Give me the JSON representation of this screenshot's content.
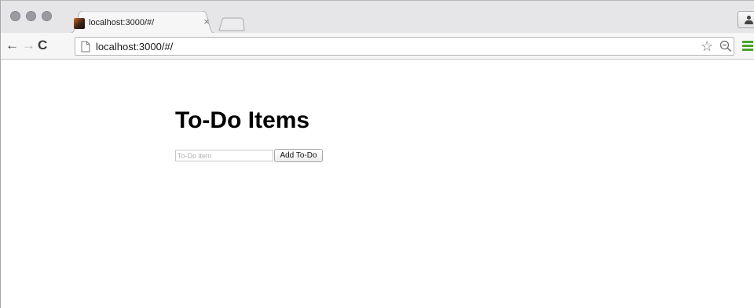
{
  "browser": {
    "tab": {
      "title": "localhost:3000/#/",
      "close_glyph": "×",
      "favicon": "site-favicon"
    },
    "toolbar": {
      "back_glyph": "←",
      "forward_glyph": "→",
      "reload_glyph": "C",
      "url": "localhost:3000/#/",
      "bookmark_glyph": "☆"
    },
    "menu_color": "#4aa52e"
  },
  "page": {
    "title": "To-Do Items",
    "input": {
      "placeholder": "To-Do item",
      "value": ""
    },
    "add_button_label": "Add To-Do"
  }
}
